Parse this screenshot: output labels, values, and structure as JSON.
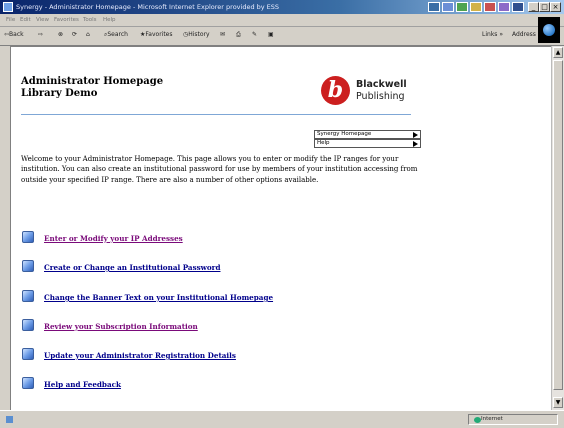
{
  "window": {
    "title": "Synergy - Administrator Homepage - Microsoft Internet Explorer provided by ESS"
  },
  "menu": {
    "items": [
      "File",
      "Edit",
      "View",
      "Favorites",
      "Tools",
      "Help"
    ]
  },
  "toolbar": {
    "back": "Back",
    "search": "Search",
    "favorites": "Favorites",
    "history": "History",
    "links": "Links",
    "address": "Address"
  },
  "page": {
    "heading_line1": "Administrator Homepage",
    "heading_line2": "Library Demo",
    "logo": {
      "line1": "Blackwell",
      "line2": "Publishing",
      "color": "#cc1f1f"
    },
    "dropdowns": [
      {
        "value": "Synergy Homepage"
      },
      {
        "value": "Help"
      }
    ],
    "intro": "Welcome to your Administrator Homepage. This page allows you to enter or modify the IP ranges for your institution. You can also create an institutional password for use by members of your institution accessing from outside your specified IP range. There are also a number of other options available.",
    "links": [
      {
        "label": "Enter or Modify your IP Addresses",
        "color": "#7a0a7a"
      },
      {
        "label": "Create or Change an Institutional Password",
        "color": "#00008b"
      },
      {
        "label": "Change the Banner Text on your Institutional Homepage",
        "color": "#00008b"
      },
      {
        "label": "Review your Subscription Information",
        "color": "#7a0a7a"
      },
      {
        "label": "Update your Administrator Registration Details",
        "color": "#00008b"
      },
      {
        "label": "Help and Feedback",
        "color": "#00008b"
      }
    ]
  },
  "status": {
    "zone": "Internet"
  }
}
